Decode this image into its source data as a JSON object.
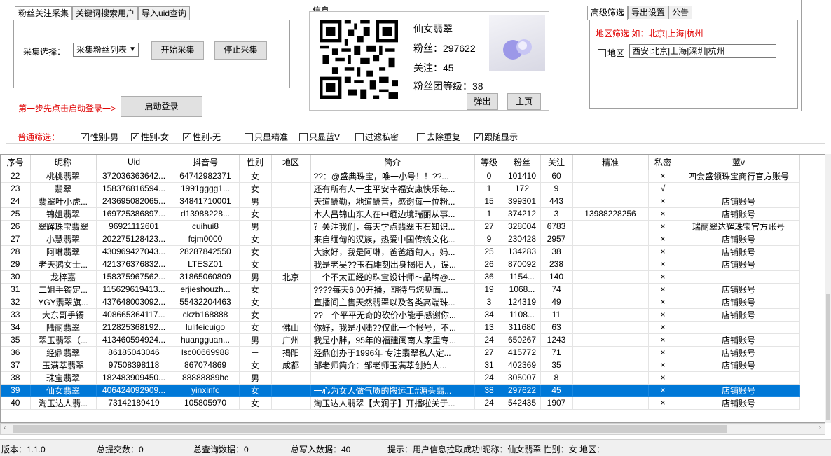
{
  "left_tabs": [
    "粉丝关注采集",
    "关键词搜索用户",
    "导入uid查询"
  ],
  "collect": {
    "select_label": "采集选择：",
    "select_value": "采集粉丝列表",
    "start_button": "开始采集",
    "stop_button": "停止采集"
  },
  "login": {
    "hint": "第一步先点击启动登录一>",
    "button": "启动登录"
  },
  "info": {
    "title": "信息",
    "name": "仙女翡翠",
    "fans": "粉丝：297622",
    "follow": "关注：45",
    "fan_group": "粉丝团等级：38",
    "popup_button": "弹出",
    "home_button": "主页"
  },
  "right_tabs": [
    "高级筛选",
    "导出设置",
    "公告"
  ],
  "region": {
    "hint": "地区筛选 如：北京|上海|杭州",
    "checkbox_label": "地区",
    "input_value": "西安|北京|上海|深圳|杭州"
  },
  "filters": {
    "label": "普通筛选：",
    "items": [
      {
        "label": "性别-男",
        "checked": true
      },
      {
        "label": "性别-女",
        "checked": true
      },
      {
        "label": "性别-无",
        "checked": true
      },
      {
        "label": "只显精准",
        "checked": false
      },
      {
        "label": "只显蓝V",
        "checked": false
      },
      {
        "label": "过滤私密",
        "checked": false
      },
      {
        "label": "去除重复",
        "checked": false
      },
      {
        "label": "跟随显示",
        "checked": true
      }
    ]
  },
  "table": {
    "columns": [
      "序号",
      "昵称",
      "Uid",
      "抖音号",
      "性别",
      "地区",
      "简介",
      "等级",
      "粉丝",
      "关注",
      "精准",
      "私密",
      "蓝v"
    ],
    "selected_row": 39,
    "rows": [
      [
        "22",
        "桃桃翡翠",
        "372036363642...",
        "64742982371",
        "女",
        "",
        "??：@盛典珠宝，唯一小号！！??...",
        "0",
        "101410",
        "60",
        "",
        "×",
        "四会盛领珠宝商行官方账号"
      ],
      [
        "23",
        "翡翠",
        "158376816594...",
        "1991gggg1...",
        "女",
        "",
        "还有所有人一生平安幸福安康快乐每...",
        "1",
        "172",
        "9",
        "",
        "√",
        ""
      ],
      [
        "24",
        "翡翠叶小虎...",
        "243695082065...",
        "34841710001",
        "男",
        "",
        "天道酬勤，地道酬善，感谢每一位粉...",
        "15",
        "399301",
        "443",
        "",
        "×",
        "店铺账号"
      ],
      [
        "25",
        "锦姐翡翠",
        "169725386897...",
        "d13988228...",
        "女",
        "",
        "本人吕锦山东人在中缅边境瑞丽从事...",
        "1",
        "374212",
        "3",
        "13988228256",
        "×",
        "店铺账号"
      ],
      [
        "26",
        "翠辉珠宝翡翠",
        "96921112601",
        "cuihui8",
        "男",
        "",
        "？关注我们，每天学点翡翠玉石知识...",
        "27",
        "328004",
        "6783",
        "",
        "×",
        "瑞丽翠达辉珠宝官方账号"
      ],
      [
        "27",
        "小慧翡翠",
        "202275128423...",
        "fcjm0000",
        "女",
        "",
        "来自缅甸的汉族，热爱中国传统文化...",
        "9",
        "230428",
        "2957",
        "",
        "×",
        "店铺账号"
      ],
      [
        "28",
        "阿琳翡翠",
        "430969427043...",
        "28287842550",
        "女",
        "",
        "大家好，我是阿琳，爸爸缅甸人，妈...",
        "25",
        "134283",
        "38",
        "",
        "×",
        "店铺账号"
      ],
      [
        "29",
        "老天鹅女士...",
        "421376376832...",
        "LTESZ01",
        "女",
        "",
        "我是老吴??玉石雕刻出身揭阳人，误...",
        "26",
        "870092",
        "238",
        "",
        "×",
        "店铺账号"
      ],
      [
        "30",
        "龙梓嘉",
        "158375967562...",
        "31865060809",
        "男",
        "北京",
        "一个不太正经的珠宝设计师～品牌@...",
        "36",
        "1154...",
        "140",
        "",
        "×",
        ""
      ],
      [
        "31",
        "二姐手镯定...",
        "115629619413...",
        "erjieshouzh...",
        "女",
        "",
        "????每天6:00开播，期待与您见面...",
        "19",
        "1068...",
        "74",
        "",
        "×",
        "店铺账号"
      ],
      [
        "32",
        "YGY翡翠旗...",
        "437648003092...",
        "55432204463",
        "女",
        "",
        "直播间主售天然翡翠以及各类高端珠...",
        "3",
        "124319",
        "49",
        "",
        "×",
        "店铺账号"
      ],
      [
        "33",
        "大东哥手镯",
        "408665364117...",
        "ckzb168888",
        "女",
        "",
        "??一个平平无奇的砍价小能手感谢你...",
        "34",
        "1108...",
        "11",
        "",
        "×",
        "店铺账号"
      ],
      [
        "34",
        "陆丽翡翠",
        "212825368192...",
        "lulifeicuigo",
        "女",
        "佛山",
        "你好，我是小陆??仅此一个帐号，不...",
        "13",
        "311680",
        "63",
        "",
        "×",
        ""
      ],
      [
        "35",
        "翠玉翡翠（...",
        "413460594924...",
        "huangguan...",
        "男",
        "广州",
        "我是小胖，95年的福建闽南人家里专...",
        "24",
        "650267",
        "1243",
        "",
        "×",
        "店铺账号"
      ],
      [
        "36",
        "经鼎翡翠",
        "86185043046",
        "lsc00669988",
        "－",
        "揭阳",
        "经鼎创办于1996年 专注翡翠私人定...",
        "27",
        "415772",
        "71",
        "",
        "×",
        "店铺账号"
      ],
      [
        "37",
        "玉满萃翡翠",
        "97508398118",
        "867074869",
        "女",
        "成都",
        "邹老师简介：邹老师玉满萃创始人...",
        "31",
        "402369",
        "35",
        "",
        "×",
        "店铺账号"
      ],
      [
        "38",
        "珠宝翡翠",
        "182483909450...",
        "88888889hc",
        "男",
        "",
        "",
        "24",
        "305007",
        "8",
        "",
        "×",
        ""
      ],
      [
        "39",
        "仙女翡翠",
        "406424092909...",
        "yinxinfc",
        "女",
        "",
        "一心为女人做气质的搬运工#源头翡...",
        "38",
        "297622",
        "45",
        "",
        "×",
        "店铺账号"
      ],
      [
        "40",
        "淘玉达人翡...",
        "73142189419",
        "105805970",
        "女",
        "",
        "淘玉达人翡翠【大润子】开播啦关于...",
        "24",
        "542435",
        "1907",
        "",
        "×",
        "店铺账号"
      ]
    ]
  },
  "status": {
    "version": "版本：1.1.0",
    "total_submit": "总提交数：0",
    "total_query": "总查询数据：0",
    "total_written": "总写入数据：40",
    "hint": "提示：用户信息拉取成功!昵称：仙女翡翠 性别：女 地区："
  }
}
